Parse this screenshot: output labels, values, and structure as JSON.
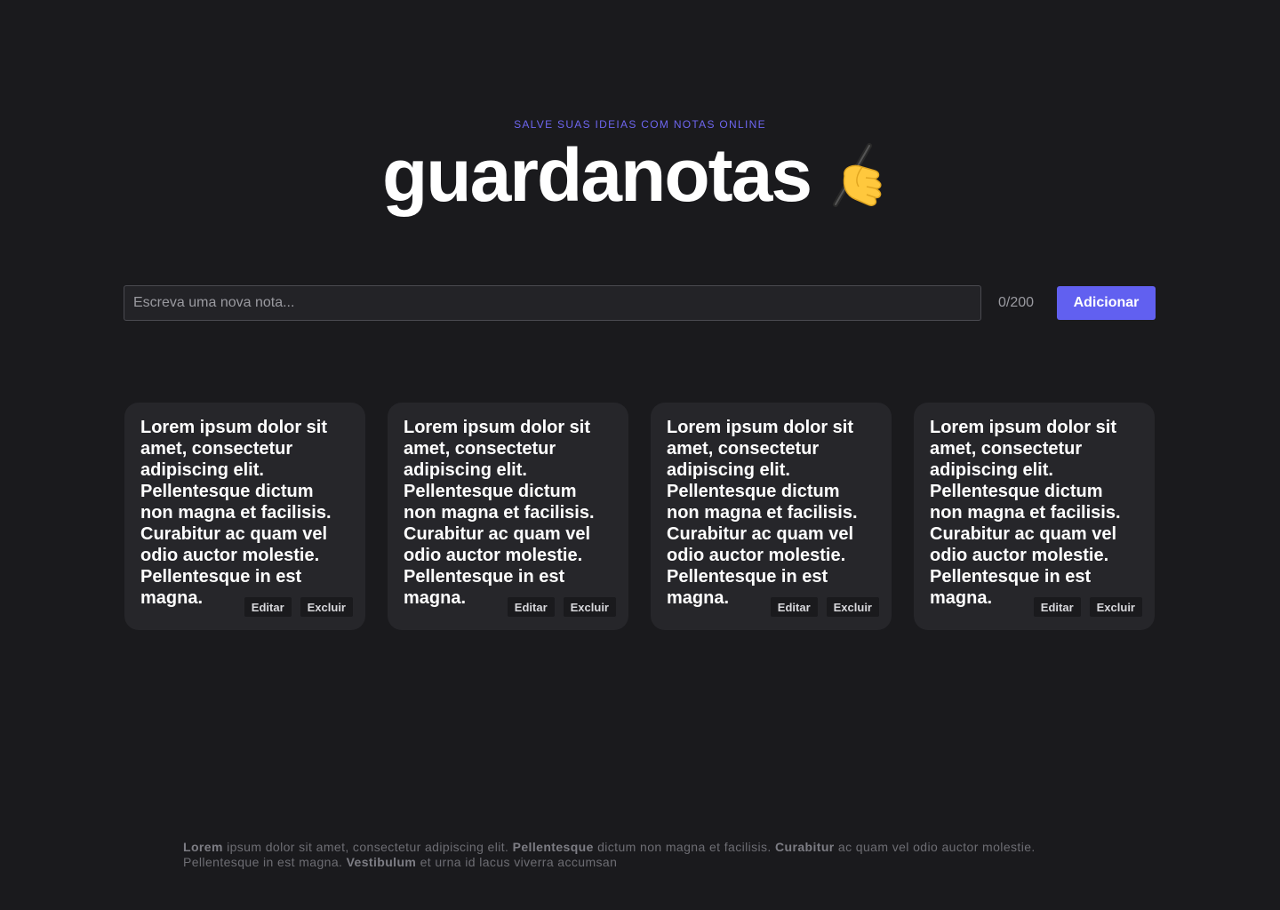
{
  "header": {
    "tagline": "SALVE SUAS IDEIAS COM NOTAS ONLINE",
    "title": "guardanotas",
    "title_icon": "writing-hand-icon"
  },
  "composer": {
    "placeholder": "Escreva uma nova nota...",
    "value": "",
    "counter": "0/200",
    "add_label": "Adicionar"
  },
  "colors": {
    "background": "#1a1a1d",
    "accent": "#6160f0",
    "card": "#26262a"
  },
  "notes": [
    {
      "text": "Lorem ipsum dolor sit amet, consectetur adipiscing elit. Pellentesque dictum non magna et facilisis. Curabitur ac quam vel odio auctor molestie. Pellentesque in est magna.",
      "edit_label": "Editar",
      "delete_label": "Excluir"
    },
    {
      "text": "Lorem ipsum dolor sit amet, consectetur adipiscing elit. Pellentesque dictum non magna et facilisis. Curabitur ac quam vel odio auctor molestie. Pellentesque in est magna.",
      "edit_label": "Editar",
      "delete_label": "Excluir"
    },
    {
      "text": "Lorem ipsum dolor sit amet, consectetur adipiscing elit. Pellentesque dictum non magna et facilisis. Curabitur ac quam vel odio auctor molestie. Pellentesque in est magna.",
      "edit_label": "Editar",
      "delete_label": "Excluir"
    },
    {
      "text": "Lorem ipsum dolor sit amet, consectetur adipiscing elit. Pellentesque dictum non magna et facilisis. Curabitur ac quam vel odio auctor molestie. Pellentesque in est magna.",
      "edit_label": "Editar",
      "delete_label": "Excluir"
    }
  ],
  "footer": {
    "bold_1": "Lorem",
    "text_1": " ipsum dolor sit amet, consectetur adipiscing elit. ",
    "bold_2": "Pellentesque",
    "text_2": " dictum non magna et facilisis. ",
    "bold_3": "Curabitur",
    "text_3": " ac quam vel odio auctor molestie. Pellentesque in est magna. ",
    "bold_4": "Vestibulum",
    "text_4": " et urna id lacus viverra accumsan"
  }
}
